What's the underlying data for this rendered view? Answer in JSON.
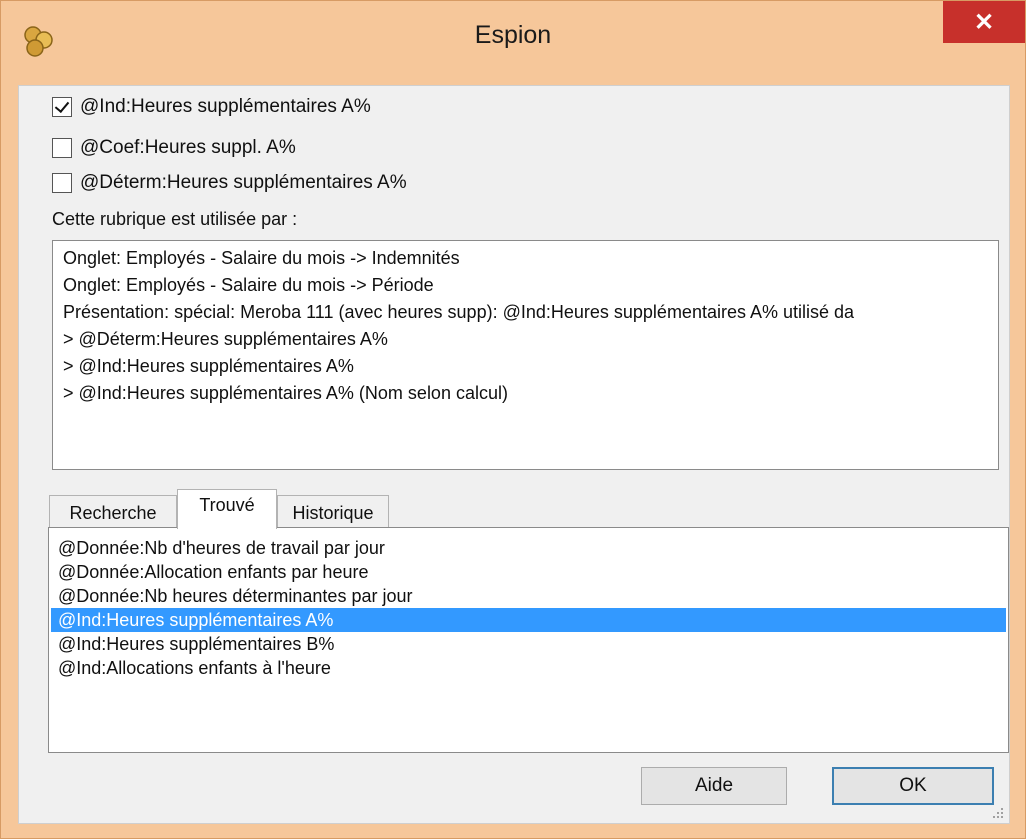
{
  "window": {
    "title": "Espion",
    "close_glyph": "✕",
    "app_icon": "coins-icon",
    "colors": {
      "frame": "#f6c79a",
      "close": "#c7302b",
      "selection": "#3399ff",
      "client": "#f0f0f0"
    }
  },
  "checkboxes": [
    {
      "label": "@Ind:Heures supplémentaires A%",
      "checked": true
    },
    {
      "label": "@Coef:Heures suppl. A%",
      "checked": false
    },
    {
      "label": "@Déterm:Heures supplémentaires A%",
      "checked": false
    }
  ],
  "used_by": {
    "label": "Cette rubrique est utilisée par :",
    "items": [
      " Onglet: Employés - Salaire du mois -> Indemnités",
      " Onglet: Employés - Salaire du mois -> Période",
      " Présentation: spécial: Meroba 111 (avec heures supp): @Ind:Heures supplémentaires A% utilisé da",
      "> @Déterm:Heures supplémentaires A%",
      "> @Ind:Heures supplémentaires A%",
      "> @Ind:Heures supplémentaires A% (Nom selon calcul)"
    ]
  },
  "tabs": [
    {
      "label": "Recherche",
      "active": false
    },
    {
      "label": "Trouvé",
      "active": true
    },
    {
      "label": "Historique",
      "active": false
    }
  ],
  "found": {
    "selected_index": 3,
    "items": [
      "@Donnée:Nb d'heures de travail par jour",
      "@Donnée:Allocation enfants par heure",
      "@Donnée:Nb heures déterminantes par jour",
      "@Ind:Heures supplémentaires A%",
      "@Ind:Heures supplémentaires B%",
      "@Ind:Allocations enfants à l'heure"
    ]
  },
  "buttons": {
    "help": "Aide",
    "ok": "OK"
  }
}
